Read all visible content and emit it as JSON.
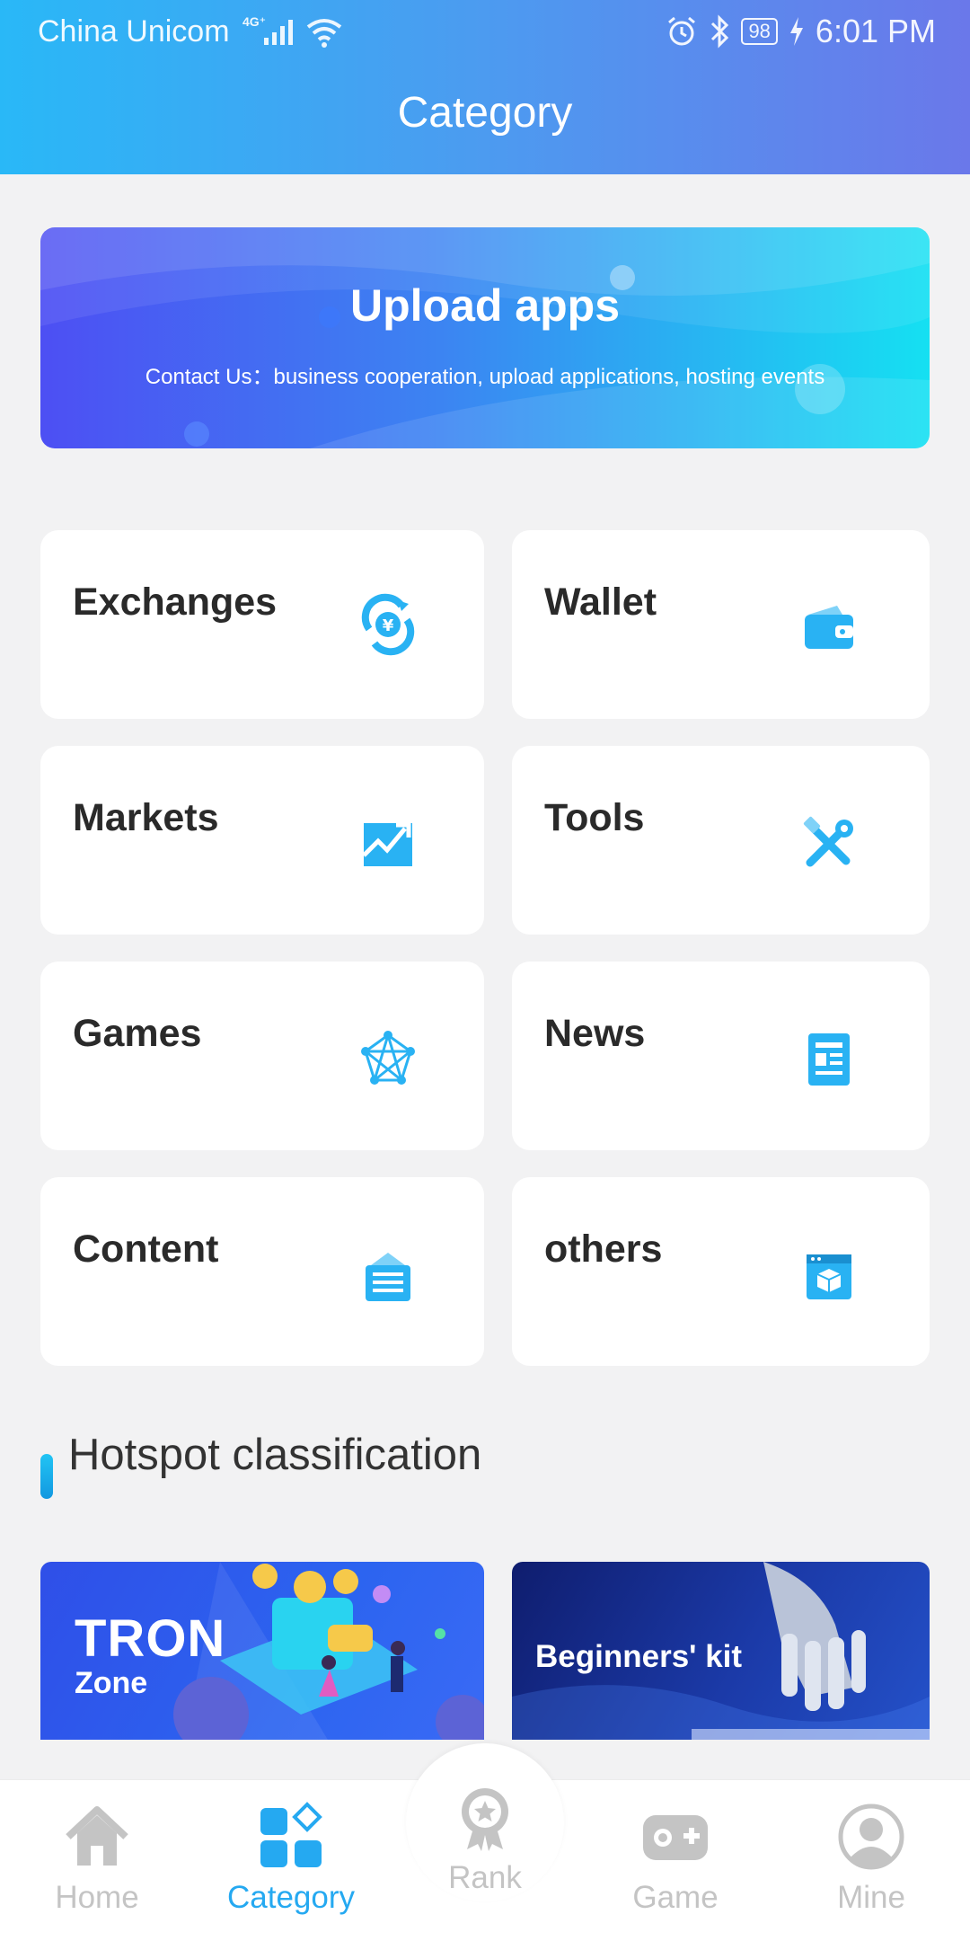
{
  "statusbar": {
    "carrier": "China Unicom",
    "network": "4G⁺",
    "battery": "98",
    "time": "6:01 PM"
  },
  "header": {
    "title": "Category"
  },
  "banner": {
    "title": "Upload apps",
    "subtitle": "Contact Us：business cooperation, upload applications, hosting events"
  },
  "categories": [
    {
      "label": "Exchanges",
      "icon": "exchange-yen-icon"
    },
    {
      "label": "Wallet",
      "icon": "wallet-icon"
    },
    {
      "label": "Markets",
      "icon": "market-chart-icon"
    },
    {
      "label": "Tools",
      "icon": "tools-icon"
    },
    {
      "label": "Games",
      "icon": "network-games-icon"
    },
    {
      "label": "News",
      "icon": "news-icon"
    },
    {
      "label": "Content",
      "icon": "content-list-icon"
    },
    {
      "label": "others",
      "icon": "others-box-icon"
    }
  ],
  "hotspot": {
    "title": "Hotspot classification",
    "promos": [
      {
        "title": "TRON",
        "subtitle": "Zone"
      },
      {
        "title": "Beginners' kit"
      }
    ]
  },
  "nav": {
    "items": [
      {
        "label": "Home",
        "icon": "home-icon"
      },
      {
        "label": "Category",
        "icon": "category-icon",
        "active": true
      },
      {
        "label": "Rank",
        "icon": "rank-medal-icon"
      },
      {
        "label": "Game",
        "icon": "gamepad-icon"
      },
      {
        "label": "Mine",
        "icon": "user-icon"
      }
    ]
  },
  "colors": {
    "accent": "#25a9f1",
    "header_start": "#29b8f7",
    "header_end": "#6a78ea",
    "inactive": "#c4c4c4"
  }
}
